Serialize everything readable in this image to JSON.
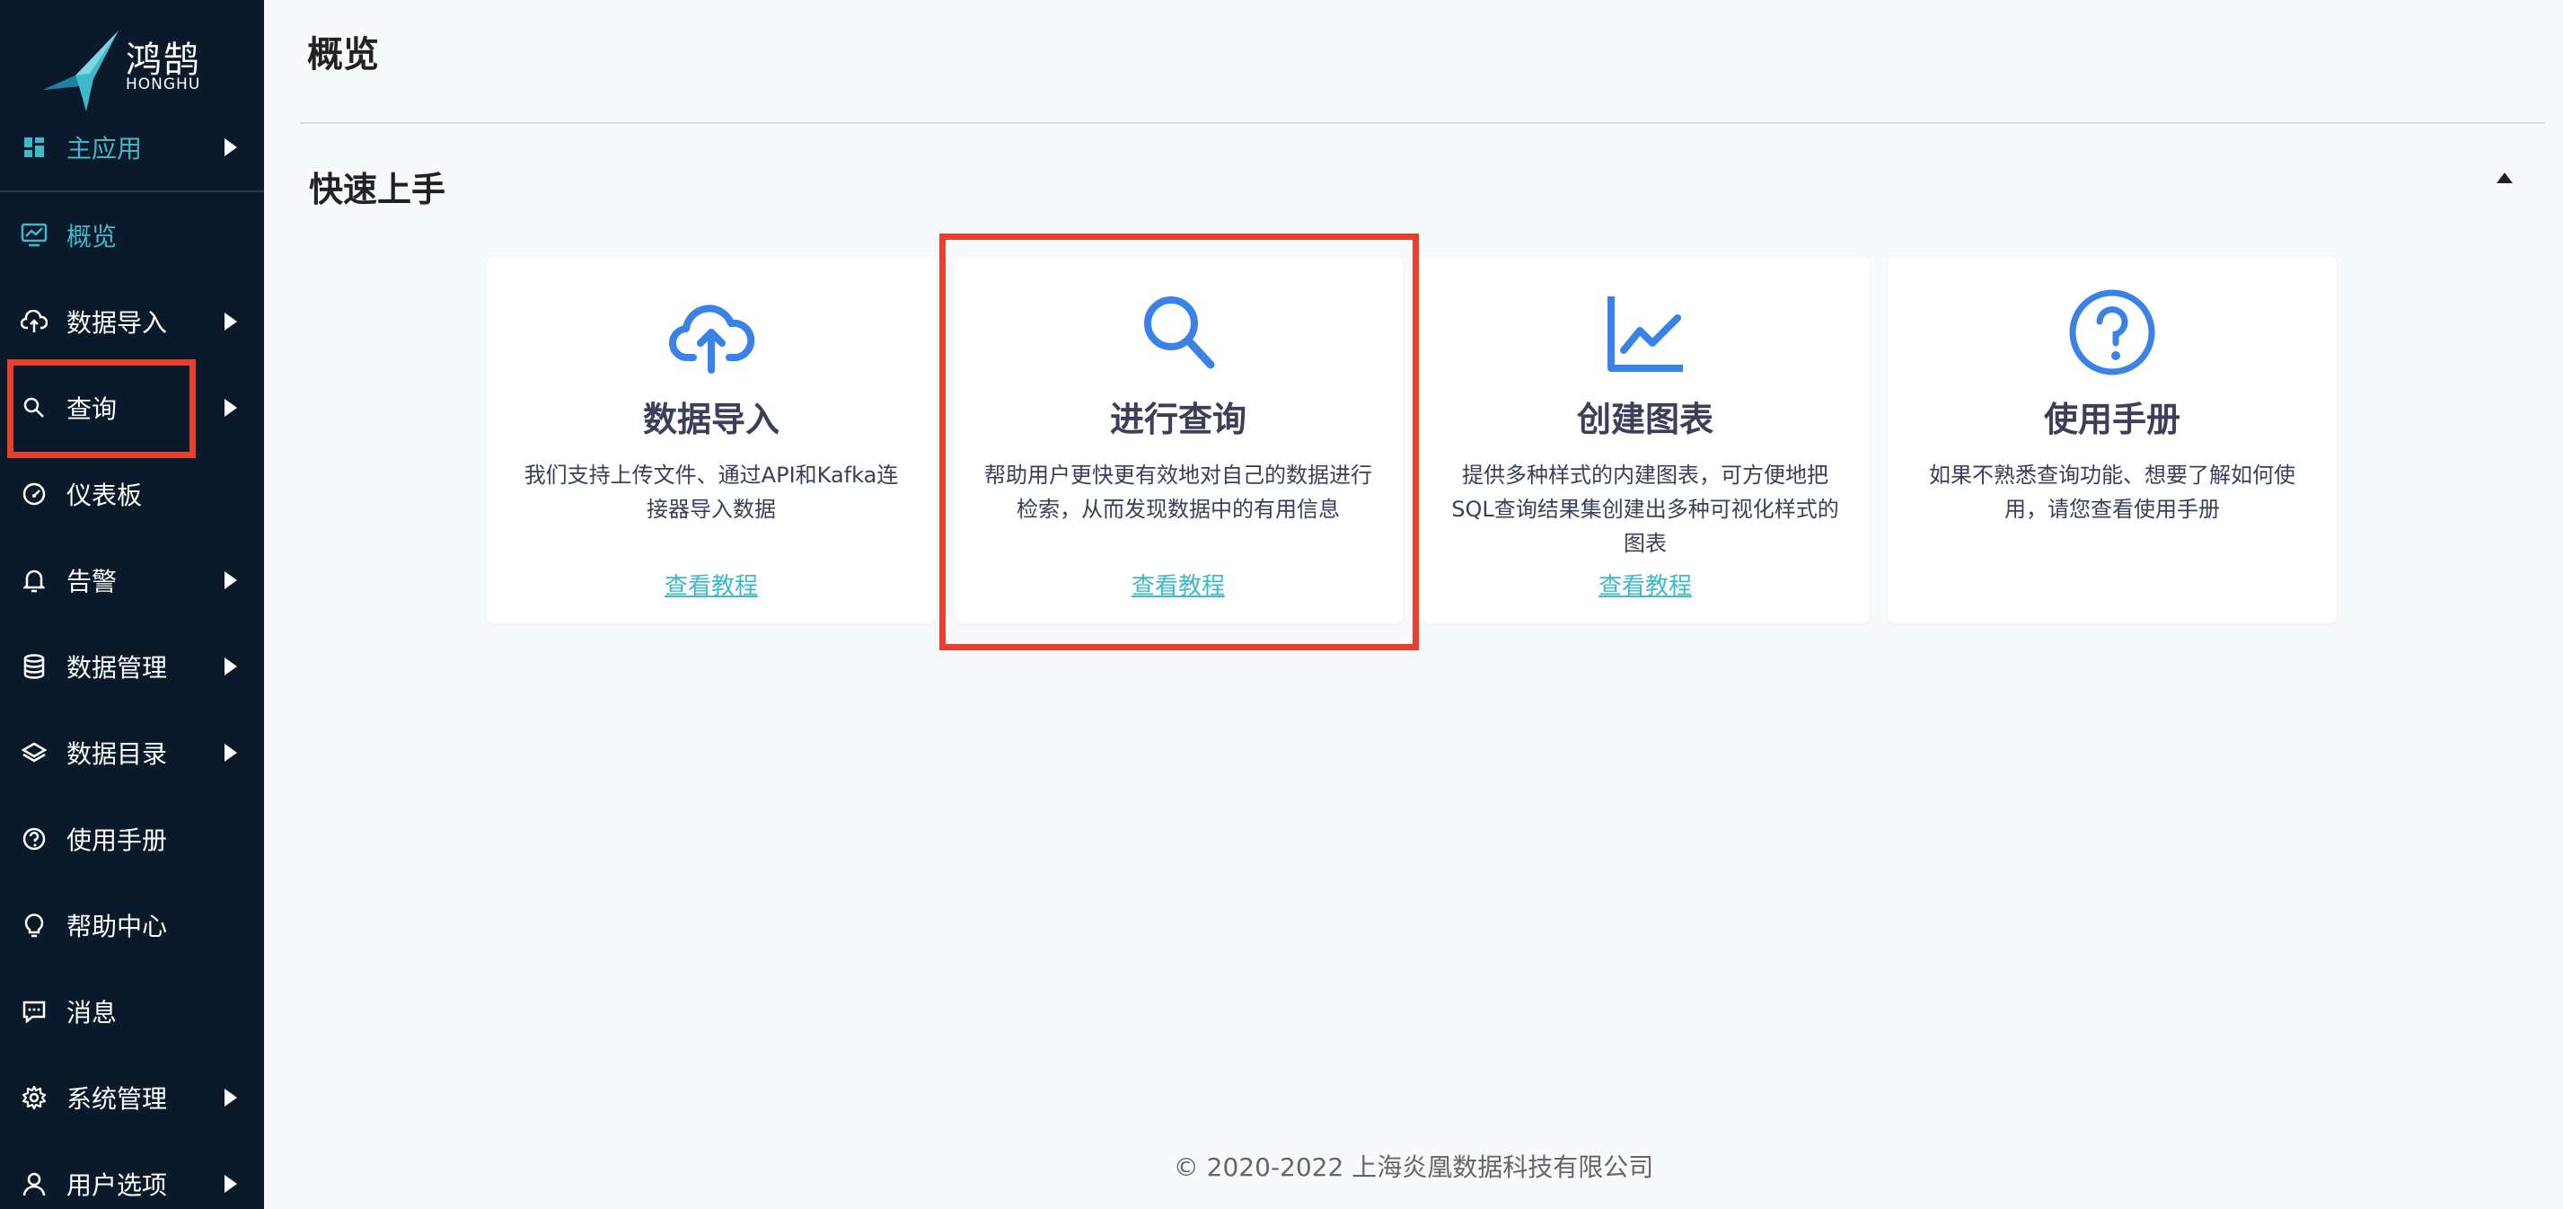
{
  "app": {
    "logo_name": "鸿鹄",
    "logo_sub": "HONGHU",
    "brand_color": "#3fb9c9",
    "highlight_color": "#e8402e",
    "sidebar_bg": "#0b1a2b"
  },
  "sidebar": {
    "items": [
      {
        "label": "主应用",
        "icon": "dashboard-grid-icon",
        "expandable": true,
        "active": true
      },
      {
        "label": "概览",
        "icon": "monitor-chart-icon",
        "expandable": false,
        "active": true
      },
      {
        "label": "数据导入",
        "icon": "cloud-upload-icon",
        "expandable": true
      },
      {
        "label": "查询",
        "icon": "search-icon",
        "expandable": true,
        "highlighted": true
      },
      {
        "label": "仪表板",
        "icon": "gauge-icon",
        "expandable": false
      },
      {
        "label": "告警",
        "icon": "bell-icon",
        "expandable": true
      },
      {
        "label": "数据管理",
        "icon": "database-icon",
        "expandable": true
      },
      {
        "label": "数据目录",
        "icon": "layers-icon",
        "expandable": true
      },
      {
        "label": "使用手册",
        "icon": "question-circle-icon",
        "expandable": false
      },
      {
        "label": "帮助中心",
        "icon": "lightbulb-icon",
        "expandable": false
      },
      {
        "label": "消息",
        "icon": "message-icon",
        "expandable": false
      },
      {
        "label": "系统管理",
        "icon": "gear-icon",
        "expandable": true
      },
      {
        "label": "用户选项",
        "icon": "user-icon",
        "expandable": true
      }
    ]
  },
  "main": {
    "page_title": "概览",
    "section_title": "快速上手",
    "cards": [
      {
        "icon": "cloud-upload-icon",
        "title": "数据导入",
        "desc": "我们支持上传文件、通过API和Kafka连接器导入数据",
        "link": "查看教程"
      },
      {
        "icon": "search-icon",
        "title": "进行查询",
        "desc": "帮助用户更快更有效地对自己的数据进行检索，从而发现数据中的有用信息",
        "link": "查看教程",
        "highlighted": true
      },
      {
        "icon": "line-chart-icon",
        "title": "创建图表",
        "desc": "提供多种样式的内建图表，可方便地把SQL查询结果集创建出多种可视化样式的图表",
        "link": "查看教程"
      },
      {
        "icon": "question-circle-icon",
        "title": "使用手册",
        "desc": "如果不熟悉查询功能、想要了解如何使用，请您查看使用手册",
        "link": ""
      }
    ]
  },
  "footer": {
    "text": "© 2020-2022 上海炎凰数据科技有限公司"
  }
}
